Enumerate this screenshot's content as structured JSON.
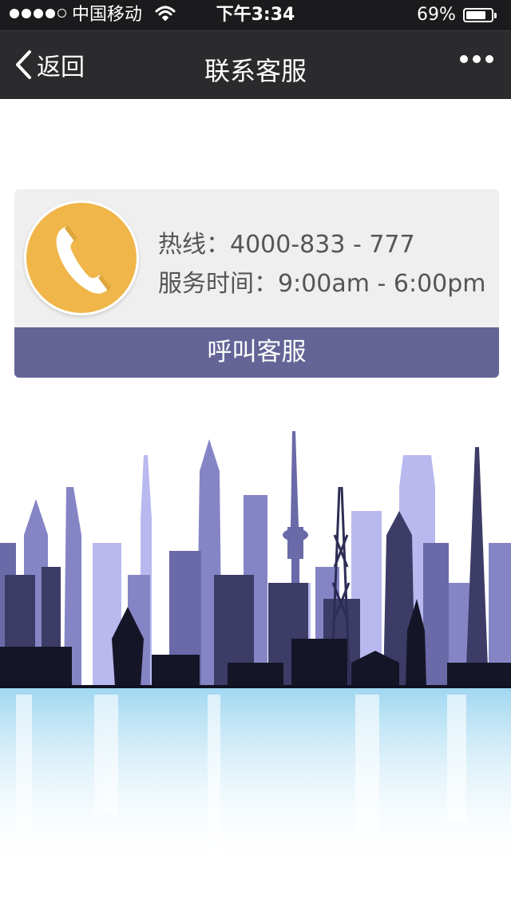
{
  "status_bar": {
    "carrier": "中国移动",
    "time": "下午3:34",
    "battery": "69%",
    "battery_level": 0.69,
    "signal_bars": 4,
    "signal_total": 5
  },
  "nav": {
    "back_label": "返回",
    "title": "联系客服",
    "more_icon": "more-dots-icon"
  },
  "contact": {
    "hotline": "热线：4000-833 - 777",
    "hours": "服务时间：9:00am - 6:00pm",
    "call_button": "呼叫客服",
    "icon": "phone-icon",
    "colors": {
      "icon_circle": "#f0b64a",
      "button": "#646497",
      "card": "#efefef"
    }
  },
  "illustration": {
    "name": "city-skyline",
    "colors": [
      "#2d2d55",
      "#5c5c9a",
      "#8c8cd0",
      "#b6b6ef",
      "#111122",
      "#a8d8f0"
    ]
  }
}
